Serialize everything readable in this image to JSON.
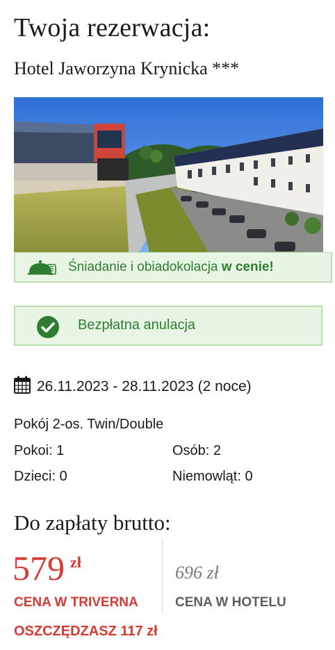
{
  "header": {
    "title": "Twoja rezerwacja:",
    "hotel_name": "Hotel Jaworzyna Krynicka ***"
  },
  "badges": {
    "meal_text": "Śniadanie i obiadokolacja",
    "meal_emph": "w cenie!",
    "meal_icon": "cloche-icon",
    "cancel_text": "Bezpłatna anulacja",
    "cancel_icon": "check-circle-icon",
    "accent_color": "#2e7d32",
    "badge_bg": "#e8f5e4"
  },
  "stay": {
    "dates": "26.11.2023 - 28.11.2023 (2 noce)",
    "date_icon": "calendar-icon",
    "room_type": "Pokój 2-os. Twin/Double",
    "rooms": "Pokoi: 1",
    "guests": "Osób: 2",
    "children": "Dzieci: 0",
    "infants": "Niemowląt: 0"
  },
  "payment": {
    "title": "Do zapłaty brutto:",
    "triverna_price": "579",
    "currency": "zł",
    "triverna_label": "CENA W TRIVERNA",
    "hotel_price": "696 zł",
    "hotel_label": "CENA W HOTELU",
    "savings": "OSZCZĘDZASZ 117 zł",
    "price_color": "#d63a32"
  }
}
